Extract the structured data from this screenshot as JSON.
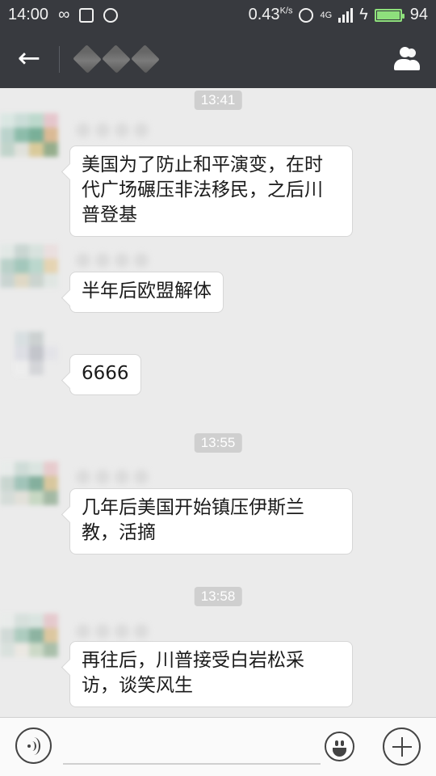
{
  "status_bar": {
    "time": "14:00",
    "infinity_icon": "infinity-icon",
    "speed": "0.43",
    "speed_unit": "K/s",
    "network": "4G",
    "battery": "94",
    "colors": {
      "background": "#383a3f",
      "battery": "#8ee07c"
    }
  },
  "header": {
    "back_icon": "back-arrow-icon",
    "title": "",
    "contacts_icon": "group-contacts-icon"
  },
  "chat": {
    "timestamps": [
      "13:41",
      "13:55",
      "13:58"
    ],
    "messages": [
      {
        "text": "美国为了防止和平演变，在时代广场碾压非法移民，之后川普登基"
      },
      {
        "text": "半年后欧盟解体"
      },
      {
        "text": "6666"
      },
      {
        "text": "几年后美国开始镇压伊斯兰教，活摘"
      },
      {
        "text": "再往后，川普接受白岩松采访，谈笑风生"
      }
    ]
  },
  "input_bar": {
    "input_value": "",
    "voice_icon": "voice-icon",
    "emoji_icon": "emoji-icon",
    "plus_icon": "plus-icon"
  }
}
